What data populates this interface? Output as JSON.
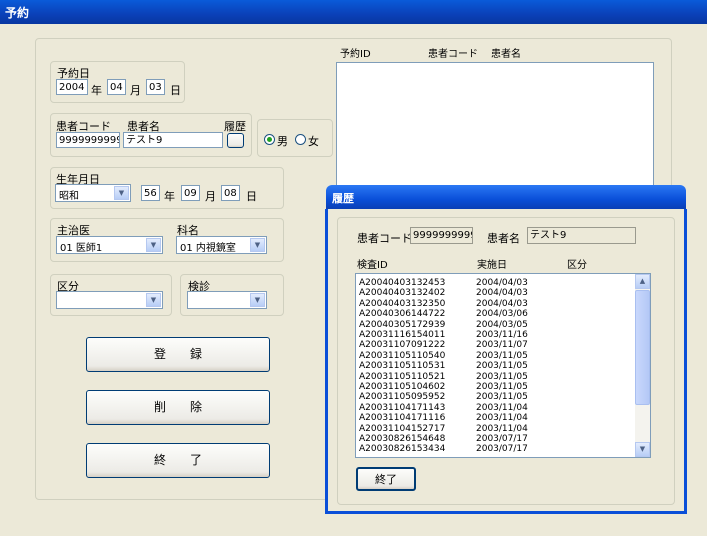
{
  "window": {
    "title": "予約"
  },
  "reservation_date": {
    "label": "予約日",
    "year": "2004",
    "year_unit": "年",
    "month": "04",
    "month_unit": "月",
    "day": "03",
    "day_unit": "日"
  },
  "patient": {
    "code_label": "患者コード",
    "name_label": "患者名",
    "history_label": "履歴",
    "code": "9999999999",
    "name": "テスト9"
  },
  "gender": {
    "male": "男",
    "female": "女",
    "selected": "男"
  },
  "birth": {
    "label": "生年月日",
    "era": "昭和",
    "year": "56",
    "year_unit": "年",
    "month": "09",
    "month_unit": "月",
    "day": "08",
    "day_unit": "日"
  },
  "doctor": {
    "label": "主治医",
    "value": "01 医師1"
  },
  "department": {
    "label": "科名",
    "value": "01 内視鏡室"
  },
  "category": {
    "label": "区分",
    "value": ""
  },
  "exam": {
    "label": "検診",
    "value": ""
  },
  "buttons": {
    "register": "登　　録",
    "delete": "削　　除",
    "exit": "終　　了"
  },
  "reservation_list": {
    "col_id": "予約ID",
    "col_code": "患者コード",
    "col_name": "患者名"
  },
  "history_dialog": {
    "title": "履歴",
    "code_label": "患者コード",
    "code": "9999999999",
    "name_label": "患者名",
    "name": "テスト9",
    "col_id": "検査ID",
    "col_date": "実施日",
    "col_category": "区分",
    "rows": [
      {
        "id": "A20040403132453",
        "date": "2004/04/03"
      },
      {
        "id": "A20040403132402",
        "date": "2004/04/03"
      },
      {
        "id": "A20040403132350",
        "date": "2004/04/03"
      },
      {
        "id": "A20040306144722",
        "date": "2004/03/06"
      },
      {
        "id": "A20040305172939",
        "date": "2004/03/05"
      },
      {
        "id": "A20031116154011",
        "date": "2003/11/16"
      },
      {
        "id": "A20031107091222",
        "date": "2003/11/07"
      },
      {
        "id": "A20031105110540",
        "date": "2003/11/05"
      },
      {
        "id": "A20031105110531",
        "date": "2003/11/05"
      },
      {
        "id": "A20031105110521",
        "date": "2003/11/05"
      },
      {
        "id": "A20031105104602",
        "date": "2003/11/05"
      },
      {
        "id": "A20031105095952",
        "date": "2003/11/05"
      },
      {
        "id": "A20031104171143",
        "date": "2003/11/04"
      },
      {
        "id": "A20031104171116",
        "date": "2003/11/04"
      },
      {
        "id": "A20031104152717",
        "date": "2003/11/04"
      },
      {
        "id": "A20030826154648",
        "date": "2003/07/17"
      },
      {
        "id": "A20030826153434",
        "date": "2003/07/17"
      }
    ],
    "close": "終了"
  }
}
